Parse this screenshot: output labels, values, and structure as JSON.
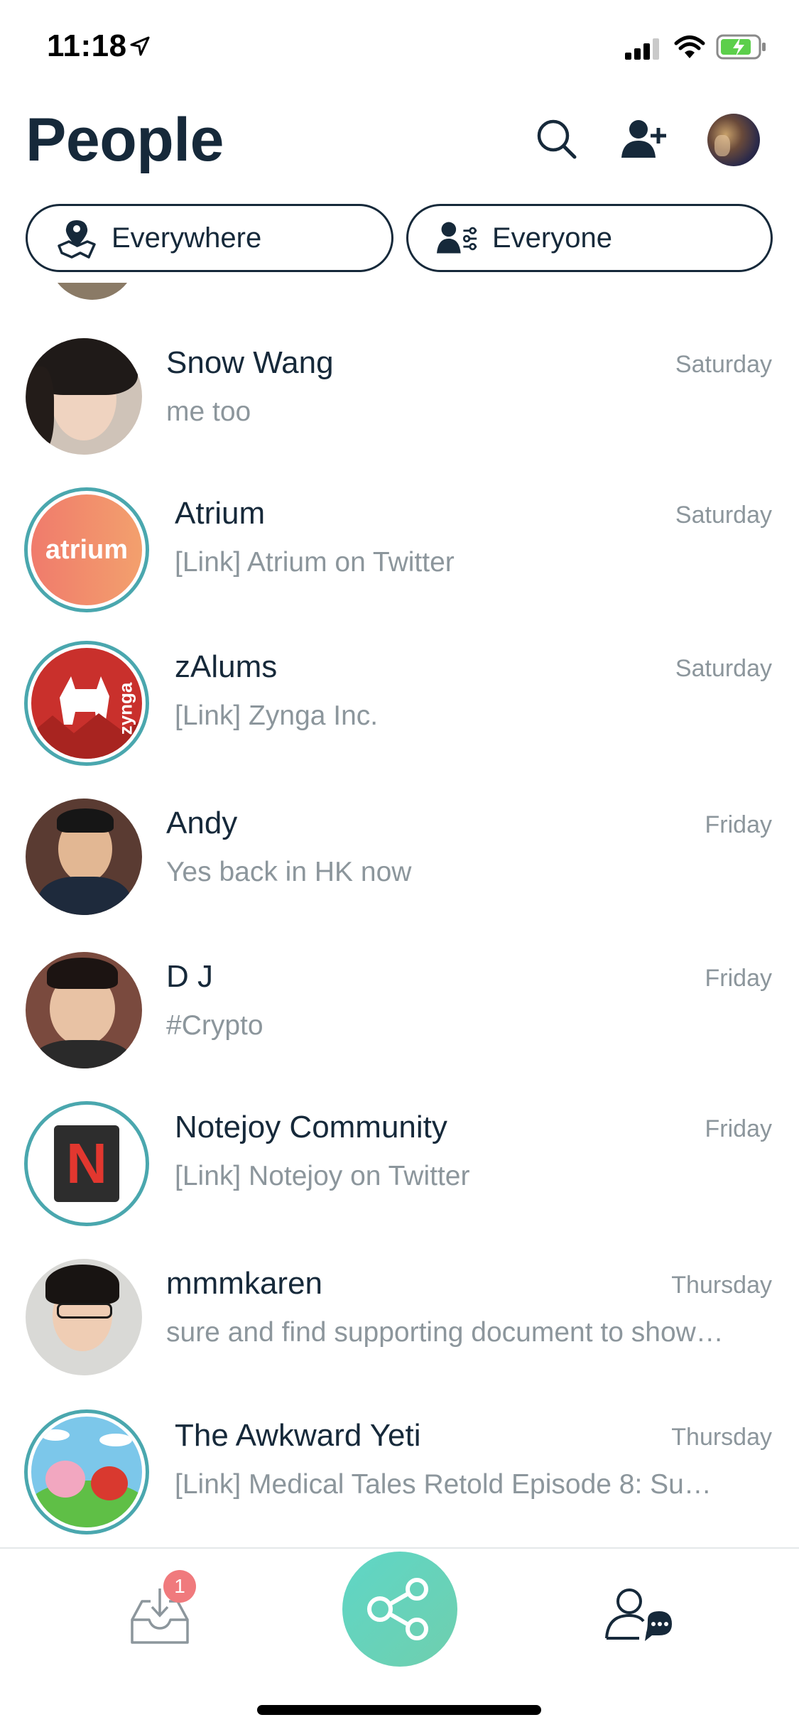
{
  "status_bar": {
    "time": "11:18"
  },
  "header": {
    "title": "People"
  },
  "filters": {
    "location": "Everywhere",
    "audience": "Everyone"
  },
  "conversations": [
    {
      "name": "Snow Wang",
      "preview": "me too",
      "time": "Saturday",
      "avatar": "photo"
    },
    {
      "name": "Atrium",
      "preview": "[Link] Atrium on Twitter",
      "time": "Saturday",
      "avatar": "atrium-logo",
      "avatar_text": "atrium"
    },
    {
      "name": "zAlums",
      "preview": "[Link] Zynga Inc.",
      "time": "Saturday",
      "avatar": "zynga-logo",
      "avatar_text": "zynga"
    },
    {
      "name": "Andy",
      "preview": "Yes back in HK now",
      "time": "Friday",
      "avatar": "photo"
    },
    {
      "name": "D J",
      "preview": "#Crypto",
      "time": "Friday",
      "avatar": "photo"
    },
    {
      "name": "Notejoy Community",
      "preview": "[Link] Notejoy on Twitter",
      "time": "Friday",
      "avatar": "notejoy-logo",
      "avatar_text": "N"
    },
    {
      "name": "mmmkaren",
      "preview": "sure and find supporting document to show…",
      "time": "Thursday",
      "avatar": "photo"
    },
    {
      "name": "The Awkward Yeti",
      "preview": "[Link] Medical Tales Retold Episode 8: Su…",
      "time": "Thursday",
      "avatar": "yeti-illustration"
    }
  ],
  "tab_bar": {
    "inbox_badge": "1",
    "icons": [
      "inbox-icon",
      "share-icon",
      "people-chat-icon"
    ]
  },
  "colors": {
    "primary_text": "#16293a",
    "secondary_text": "#8c969c",
    "ring": "#4aa7ae",
    "accent": "#5fd6c6",
    "badge": "#f07a7d"
  }
}
